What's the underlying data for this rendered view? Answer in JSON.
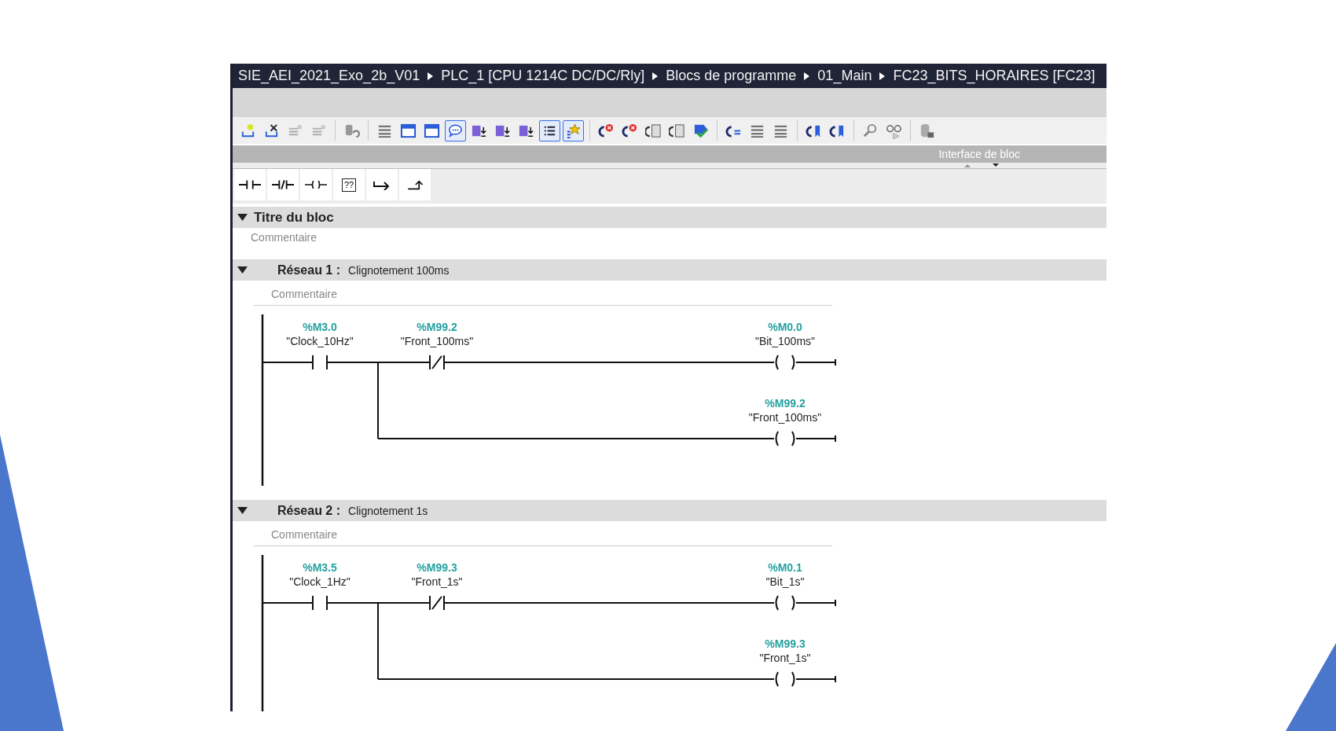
{
  "breadcrumb": [
    {
      "label": "SIE_AEI_2021_Exo_2b_V01"
    },
    {
      "label": "PLC_1 [CPU 1214C DC/DC/Rly]"
    },
    {
      "label": "Blocs de programme"
    },
    {
      "label": "01_Main"
    },
    {
      "label": "FC23_BITS_HORAIRES [FC23]"
    }
  ],
  "toolbar_buttons": [
    {
      "pressed": false
    },
    {
      "pressed": false
    },
    {
      "pressed": false
    },
    {
      "pressed": false
    },
    {
      "pressed": false
    },
    {
      "pressed": false
    },
    {
      "pressed": false
    },
    {
      "pressed": false
    },
    {
      "pressed": true
    },
    {
      "pressed": false
    },
    {
      "pressed": false
    },
    {
      "pressed": false
    },
    {
      "pressed": true
    },
    {
      "pressed": true
    },
    {
      "pressed": false
    },
    {
      "pressed": false
    },
    {
      "pressed": false
    },
    {
      "pressed": false
    },
    {
      "pressed": false
    },
    {
      "pressed": false
    },
    {
      "pressed": false
    },
    {
      "pressed": false
    },
    {
      "pressed": false
    },
    {
      "pressed": false
    },
    {
      "pressed": false
    },
    {
      "pressed": false
    },
    {
      "pressed": false
    }
  ],
  "interface_panel": {
    "title": "Interface de bloc"
  },
  "instruction_palette": [
    {
      "kind": "contact_no"
    },
    {
      "kind": "contact_nc"
    },
    {
      "kind": "coil"
    },
    {
      "kind": "box",
      "label": "??"
    },
    {
      "kind": "branch_open"
    },
    {
      "kind": "branch_close"
    }
  ],
  "block_title": {
    "title": "Titre du bloc",
    "expanded": true,
    "comment": "Commentaire"
  },
  "networks": [
    {
      "label": "Réseau 1 :",
      "title": "Clignotement 100ms",
      "expanded": true,
      "comment": "Commentaire",
      "main_rung": [
        {
          "kind": "contact_no",
          "address": "%M3.0",
          "tag": "\"Clock_10Hz\""
        },
        {
          "kind": "contact_nc",
          "address": "%M99.2",
          "tag": "\"Front_100ms\""
        },
        {
          "kind": "coil",
          "address": "%M0.0",
          "tag": "\"Bit_100ms\""
        }
      ],
      "branch": [
        {
          "kind": "coil",
          "address": "%M99.2",
          "tag": "\"Front_100ms\""
        }
      ]
    },
    {
      "label": "Réseau 2 :",
      "title": "Clignotement 1s",
      "expanded": true,
      "comment": "Commentaire",
      "main_rung": [
        {
          "kind": "contact_no",
          "address": "%M3.5",
          "tag": "\"Clock_1Hz\""
        },
        {
          "kind": "contact_nc",
          "address": "%M99.3",
          "tag": "\"Front_1s\""
        },
        {
          "kind": "coil",
          "address": "%M0.1",
          "tag": "\"Bit_1s\""
        }
      ],
      "branch": [
        {
          "kind": "coil",
          "address": "%M99.3",
          "tag": "\"Front_1s\""
        }
      ]
    }
  ]
}
